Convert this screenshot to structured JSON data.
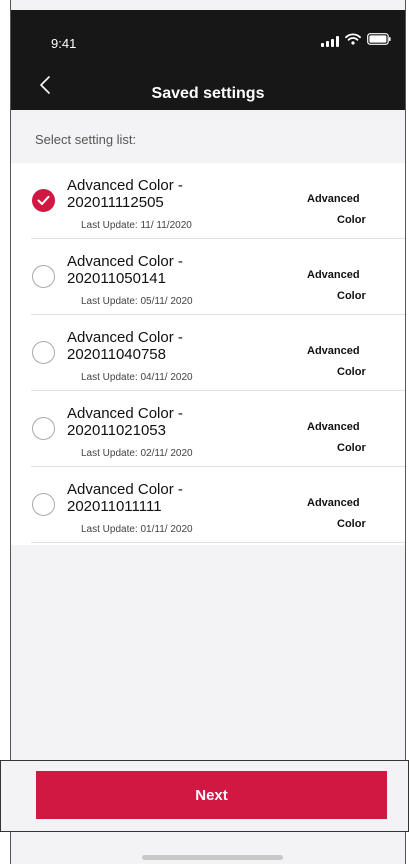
{
  "status": {
    "time": "9:41"
  },
  "header": {
    "title": "Saved settings"
  },
  "section": {
    "label": "Select setting list:"
  },
  "items": [
    {
      "name_line1": "Advanced Color -",
      "name_line2": "202011112505",
      "last_update": "Last Update:  11/ 11/2020",
      "tag_line1": "Advanced",
      "tag_line2": "Color",
      "selected": true
    },
    {
      "name_line1": "Advanced Color -",
      "name_line2": "202011050141",
      "last_update": "Last Update: 05/11/ 2020",
      "tag_line1": "Advanced",
      "tag_line2": "Color",
      "selected": false
    },
    {
      "name_line1": "Advanced Color -",
      "name_line2": "202011040758",
      "last_update": "Last Update: 04/11/ 2020",
      "tag_line1": "Advanced",
      "tag_line2": "Color",
      "selected": false
    },
    {
      "name_line1": "Advanced Color -",
      "name_line2": "202011021053",
      "last_update": "Last Update: 02/11/ 2020",
      "tag_line1": "Advanced",
      "tag_line2": "Color",
      "selected": false
    },
    {
      "name_line1": "Advanced Color -",
      "name_line2": "202011011111",
      "last_update": "Last Update: 01/11/ 2020",
      "tag_line1": "Advanced",
      "tag_line2": "Color",
      "selected": false
    }
  ],
  "footer": {
    "next_label": "Next"
  },
  "colors": {
    "accent": "#d11843",
    "header_bg": "#171717"
  },
  "icons": {
    "back": "chevron-left-icon",
    "signal": "signal-icon",
    "wifi": "wifi-icon",
    "battery": "battery-icon",
    "check": "check-icon"
  }
}
